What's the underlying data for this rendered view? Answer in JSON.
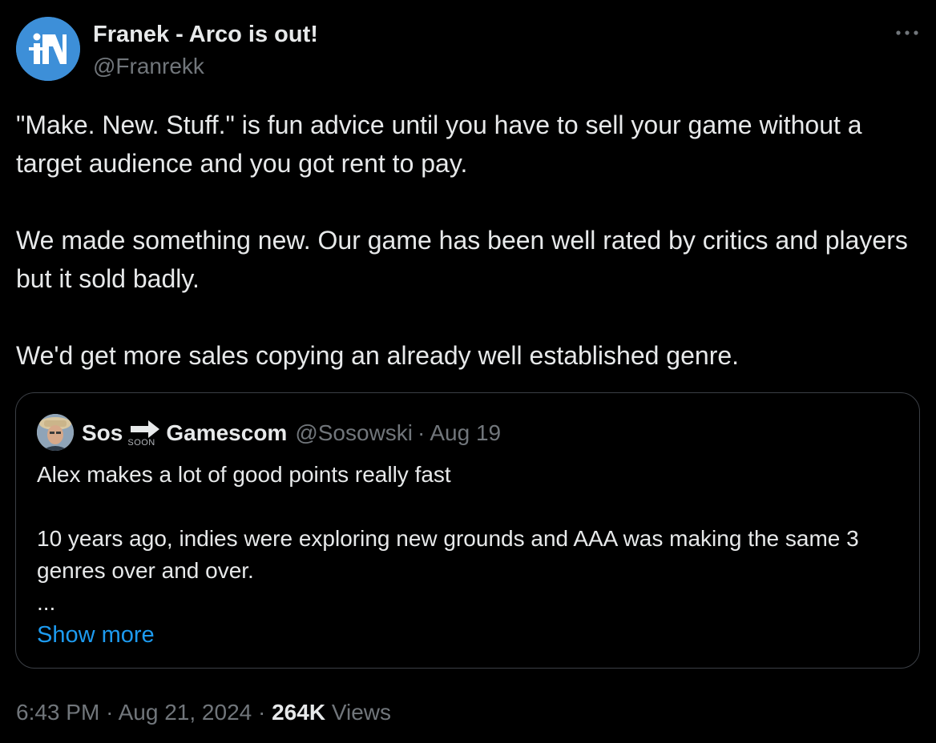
{
  "tweet": {
    "author": {
      "display_name": "Franek - Arco is out!",
      "handle": "@Franrekk",
      "avatar_color": "#3d8fd8"
    },
    "more_icon": "more-options-icon",
    "body": [
      "\"Make. New. Stuff.\" is fun advice until you have to sell your game without a target audience and you got rent to pay.",
      "We made something new. Our game has been well rated by critics and players but it sold badly.",
      "We'd get more sales copying an already well established genre."
    ],
    "quote": {
      "name_part1": "Sos",
      "arrow_icon": "arrow-right-icon",
      "soon_label": "SOON",
      "name_part2": "Gamescom",
      "handle": "@Sosowski",
      "separator": "·",
      "date": "Aug 19",
      "body": [
        "Alex makes a lot of good points really fast",
        "10 years ago, indies were exploring new grounds and AAA was making the same 3 genres over and over.",
        "..."
      ],
      "show_more": "Show more"
    },
    "meta": {
      "time": "6:43 PM",
      "separator": "·",
      "date": "Aug 21, 2024",
      "views_count": "264K",
      "views_label": "Views"
    }
  },
  "colors": {
    "background": "#000000",
    "text_primary": "#e7e9ea",
    "text_secondary": "#71767b",
    "link": "#1d9bf0",
    "border": "#3b3f45"
  }
}
